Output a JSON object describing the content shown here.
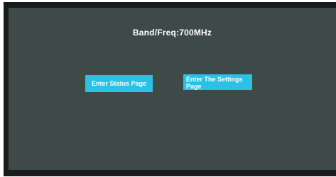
{
  "screen": {
    "title": "Band/Freq:700MHz"
  },
  "buttons": {
    "status_label": "Enter Status Page",
    "settings_label_line1": "Enter The Settings",
    "settings_label_line2": "Page"
  },
  "colors": {
    "frame": "#1a1a1a",
    "screen_background": "#3e4a4a",
    "button_background": "#29c2e6",
    "text": "#ffffff"
  }
}
